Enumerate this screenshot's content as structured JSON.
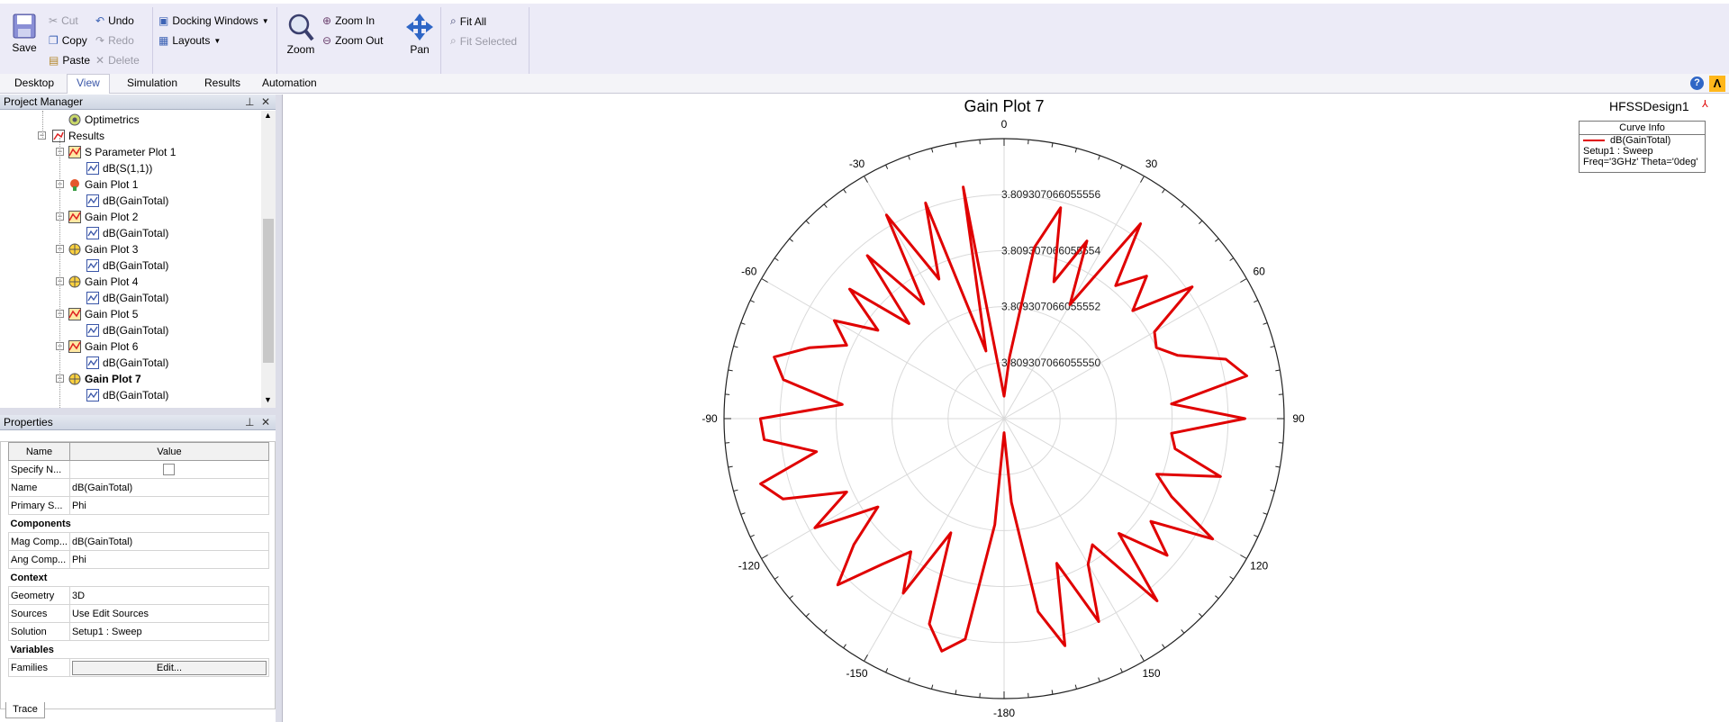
{
  "ribbon": {
    "save": "Save",
    "cut": "Cut",
    "copy": "Copy",
    "paste": "Paste",
    "undo": "Undo",
    "redo": "Redo",
    "delete": "Delete",
    "docking_windows": "Docking Windows",
    "layouts": "Layouts",
    "zoom": "Zoom",
    "zoom_in": "Zoom In",
    "zoom_out": "Zoom Out",
    "pan": "Pan",
    "fit_all": "Fit All",
    "fit_selected": "Fit Selected"
  },
  "tabs": [
    "Desktop",
    "View",
    "Simulation",
    "Results",
    "Automation"
  ],
  "active_tab": "View",
  "project_manager": {
    "title": "Project Manager",
    "tree": [
      {
        "label": "Optimetrics",
        "icon": "optimetrics-icon"
      },
      {
        "label": "Results",
        "icon": "results-icon"
      },
      {
        "label": "S Parameter Plot 1",
        "icon": "rect-plot-icon"
      },
      {
        "label": "dB(S(1,1))",
        "icon": "trace-icon"
      },
      {
        "label": "Gain Plot 1",
        "icon": "3d-plot-icon"
      },
      {
        "label": "dB(GainTotal)",
        "icon": "trace-icon"
      },
      {
        "label": "Gain Plot 2",
        "icon": "rect-plot-icon"
      },
      {
        "label": "dB(GainTotal)",
        "icon": "trace-icon"
      },
      {
        "label": "Gain Plot 3",
        "icon": "polar-plot-icon"
      },
      {
        "label": "dB(GainTotal)",
        "icon": "trace-icon"
      },
      {
        "label": "Gain Plot 4",
        "icon": "polar-plot-icon"
      },
      {
        "label": "dB(GainTotal)",
        "icon": "trace-icon"
      },
      {
        "label": "Gain Plot 5",
        "icon": "rect-plot-icon"
      },
      {
        "label": "dB(GainTotal)",
        "icon": "trace-icon"
      },
      {
        "label": "Gain Plot 6",
        "icon": "rect-plot-icon"
      },
      {
        "label": "dB(GainTotal)",
        "icon": "trace-icon"
      },
      {
        "label": "Gain Plot 7",
        "icon": "polar-plot-icon"
      },
      {
        "label": "dB(GainTotal)",
        "icon": "trace-icon"
      }
    ]
  },
  "properties": {
    "title": "Properties",
    "col_name": "Name",
    "col_value": "Value",
    "rows": [
      {
        "name": "Specify N...",
        "value": "",
        "type": "checkbox"
      },
      {
        "name": "Name",
        "value": "dB(GainTotal)"
      },
      {
        "name": "Primary S...",
        "value": "Phi"
      },
      {
        "category": "Components"
      },
      {
        "name": "Mag Comp...",
        "value": "dB(GainTotal)"
      },
      {
        "name": "Ang Comp...",
        "value": "Phi"
      },
      {
        "category": "Context"
      },
      {
        "name": "Geometry",
        "value": "3D"
      },
      {
        "name": "Sources",
        "value": "Use Edit Sources"
      },
      {
        "name": "Solution",
        "value": "Setup1 : Sweep"
      },
      {
        "category": "Variables"
      },
      {
        "name": "Families",
        "value": "Edit...",
        "type": "button"
      }
    ],
    "bottom_tab": "Trace"
  },
  "plot": {
    "design_name": "HFSSDesign1",
    "legend_title": "Curve Info",
    "legend_lines": [
      "dB(GainTotal)",
      "Setup1 : Sweep",
      "Freq='3GHz' Theta='0deg'"
    ],
    "curve_color": "#e00000"
  },
  "chart_data": {
    "type": "polar",
    "title": "Gain Plot 7",
    "angle_ticks": [
      "0",
      "30",
      "60",
      "90",
      "120",
      "150",
      "-180",
      "-150",
      "-120",
      "-90",
      "-60",
      "-30"
    ],
    "radial_ticks": [
      "3.809307066055550",
      "3.809307066055552",
      "3.809307066055554",
      "3.809307066055556"
    ],
    "series": [
      {
        "name": "dB(GainTotal)",
        "phi_deg": [
          -180,
          -175,
          -170,
          -165,
          -160,
          -155,
          -150,
          -145,
          -140,
          -135,
          -130,
          -125,
          -120,
          -115,
          -110,
          -105,
          -100,
          -95,
          -90,
          -85,
          -80,
          -75,
          -70,
          -65,
          -60,
          -55,
          -50,
          -45,
          -40,
          -35,
          -30,
          -25,
          -20,
          -15,
          -10,
          -5,
          0,
          5,
          10,
          15,
          20,
          25,
          30,
          35,
          40,
          45,
          50,
          55,
          60,
          65,
          70,
          75,
          80,
          85,
          90,
          95,
          100,
          105,
          110,
          115,
          120,
          125,
          130,
          135,
          140,
          145,
          150,
          155,
          160,
          165,
          170,
          175
        ],
        "radius_frac": [
          0.05,
          0.38,
          0.8,
          0.86,
          0.78,
          0.45,
          0.72,
          0.58,
          0.68,
          0.84,
          0.7,
          0.55,
          0.78,
          0.62,
          0.84,
          0.9,
          0.68,
          0.86,
          0.87,
          0.58,
          0.8,
          0.85,
          0.74,
          0.62,
          0.7,
          0.55,
          0.72,
          0.48,
          0.76,
          0.5,
          0.84,
          0.55,
          0.82,
          0.25,
          0.84,
          0.15,
          0.08,
          0.22,
          0.62,
          0.78,
          0.52,
          0.7,
          0.47,
          0.85,
          0.62,
          0.72,
          0.6,
          0.82,
          0.62,
          0.6,
          0.66,
          0.82,
          0.88,
          0.6,
          0.86,
          0.6,
          0.62,
          0.8,
          0.58,
          0.66,
          0.86,
          0.64,
          0.76,
          0.58,
          0.85,
          0.55,
          0.6,
          0.8,
          0.55,
          0.84,
          0.7,
          0.3
        ]
      }
    ]
  }
}
